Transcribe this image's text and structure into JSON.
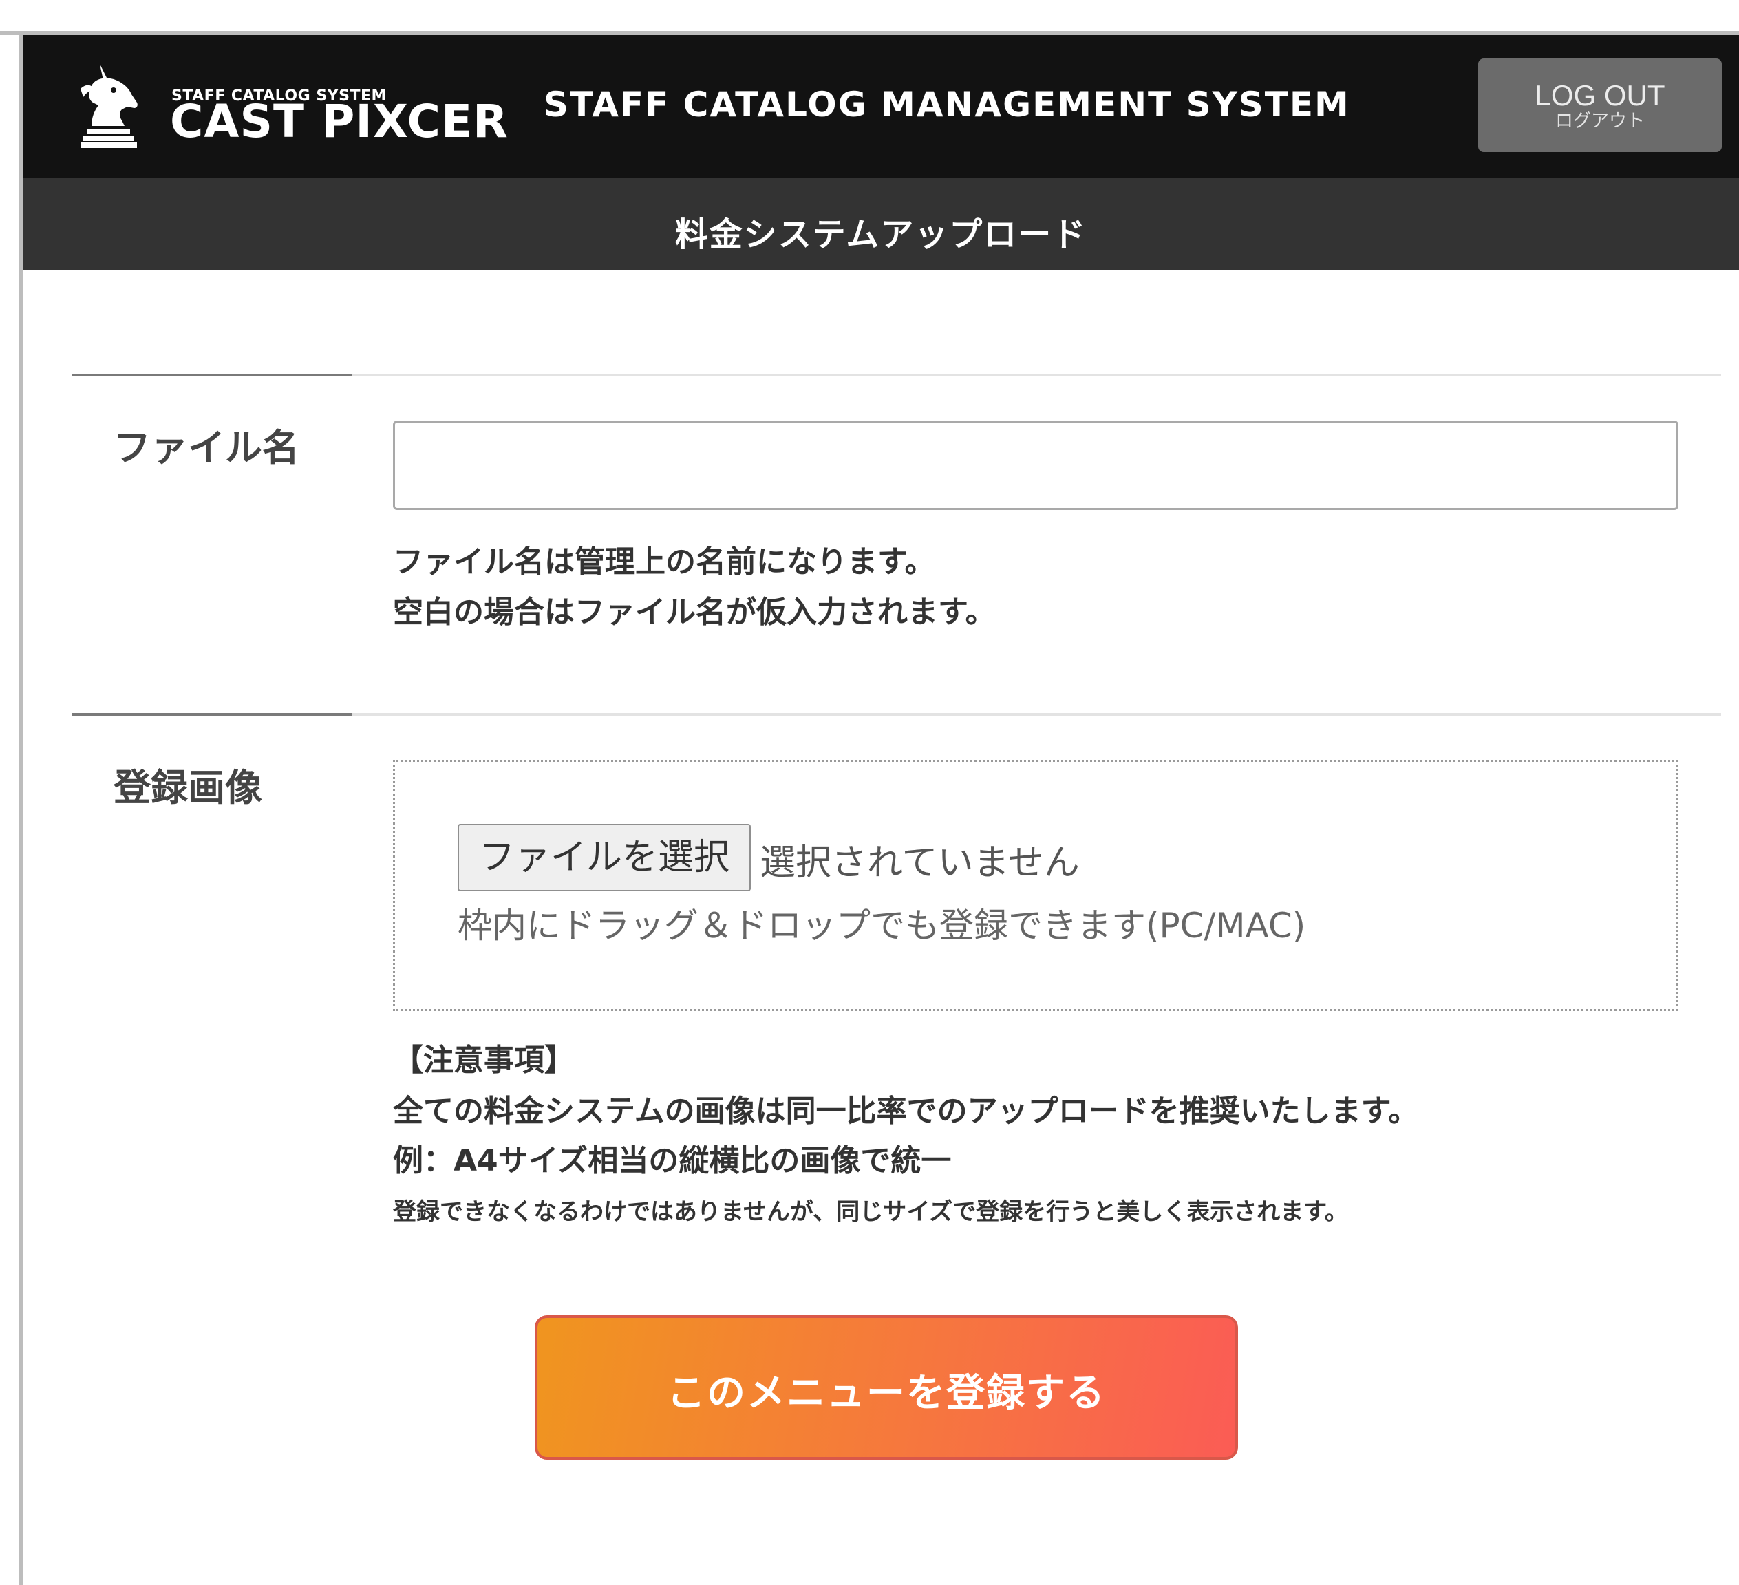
{
  "header": {
    "logo_small": "STAFF CATALOG SYSTEM",
    "logo_big": "CAST PIXCER",
    "title": "STAFF CATALOG MANAGEMENT SYSTEM",
    "logout_en": "LOG OUT",
    "logout_jp": "ログアウト"
  },
  "subheader": {
    "title": "料金システムアップロード"
  },
  "filename_section": {
    "label": "ファイル名",
    "value": "",
    "help_line1": "ファイル名は管理上の名前になります。",
    "help_line2": "空白の場合はファイル名が仮入力されます。"
  },
  "image_section": {
    "label": "登録画像",
    "file_button": "ファイルを選択",
    "file_status": "選択されていません",
    "drop_hint": "枠内にドラッグ＆ドロップでも登録できます(PC/MAC)",
    "notice_heading": "【注意事項】",
    "notice_line1": "全ての料金システムの画像は同一比率でのアップロードを推奨いたします。",
    "notice_line2": "例：A4サイズ相当の縦横比の画像で統一",
    "notice_line3": "登録できなくなるわけではありませんが、同じサイズで登録を行うと美しく表示されます。"
  },
  "submit": {
    "label": "このメニューを登録する"
  },
  "colors": {
    "header_bg": "#121212",
    "subheader_bg": "#333333",
    "logout_bg": "#6b6b6b",
    "submit_gradient_start": "#f0951f",
    "submit_gradient_end": "#fb5c55"
  },
  "icons": {
    "logo_icon": "unicorn-chess-knight-icon"
  }
}
